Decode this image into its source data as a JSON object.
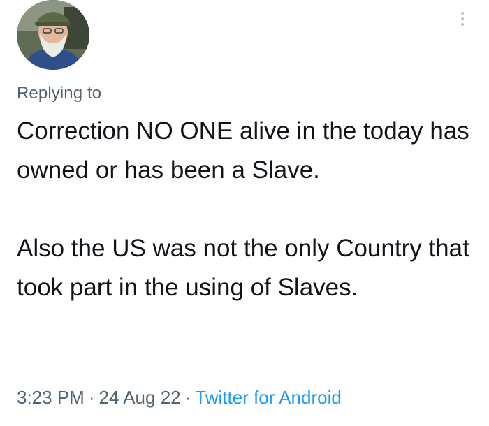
{
  "tweet": {
    "replying_label": "Replying to",
    "paragraphs": [
      "Correction NO ONE alive in the today has owned or has been a Slave.",
      "Also the US was not the only Country that took part in the using of Slaves."
    ],
    "time": "3:23 PM",
    "date": "24 Aug 22",
    "source": "Twitter for Android",
    "separator": "·"
  },
  "icons": {
    "more": "more-vertical-icon"
  },
  "colors": {
    "text": "#0f1419",
    "secondary": "#536471",
    "link": "#1d9bf0",
    "background": "#ffffff"
  }
}
